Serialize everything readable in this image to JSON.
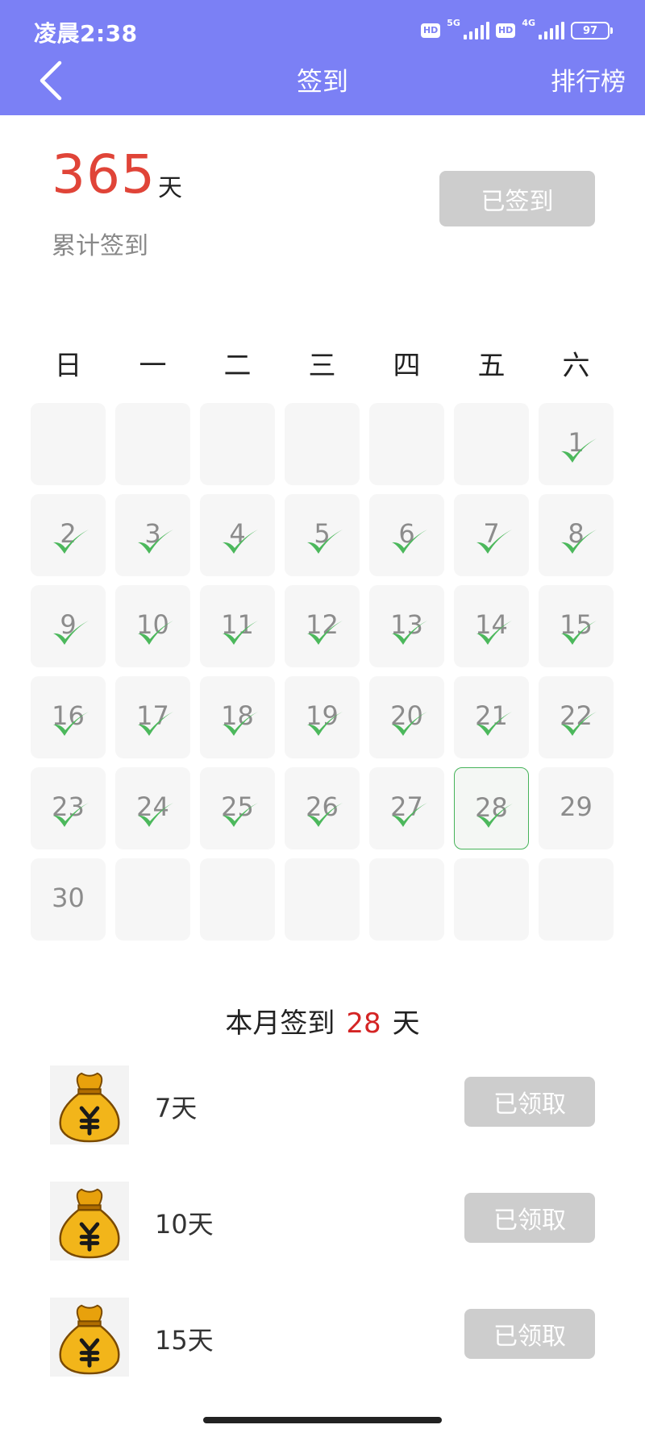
{
  "status_bar": {
    "time": "凌晨2:38",
    "hd_label": "HD",
    "net1": "5G",
    "net2": "4G",
    "battery": "97"
  },
  "nav": {
    "title": "签到",
    "right_action": "排行榜",
    "back_icon": "chevron-left-icon"
  },
  "summary": {
    "total_days": "365",
    "unit": "天",
    "label": "累计签到",
    "signin_button": "已签到"
  },
  "calendar": {
    "weekdays": [
      "日",
      "一",
      "二",
      "三",
      "四",
      "五",
      "六"
    ],
    "first_weekday_index": 6,
    "days_in_month": 30,
    "checked_days": [
      1,
      2,
      3,
      4,
      5,
      6,
      7,
      8,
      9,
      10,
      11,
      12,
      13,
      14,
      15,
      16,
      17,
      18,
      19,
      20,
      21,
      22,
      23,
      24,
      25,
      26,
      27,
      28
    ],
    "today": 28,
    "check_color": "#4cb85c",
    "today_border_color": "#46b35a"
  },
  "month_summary": {
    "prefix": "本月签到",
    "days": "28",
    "suffix": "天"
  },
  "rewards": [
    {
      "label": "7天",
      "button": "已领取",
      "icon": "money-bag-icon"
    },
    {
      "label": "10天",
      "button": "已领取",
      "icon": "money-bag-icon"
    },
    {
      "label": "15天",
      "button": "已领取",
      "icon": "money-bag-icon"
    }
  ],
  "colors": {
    "header": "#7b80f5",
    "total_number": "#e04438",
    "highlight": "#d42424",
    "disabled_button": "#cdcdcd"
  }
}
